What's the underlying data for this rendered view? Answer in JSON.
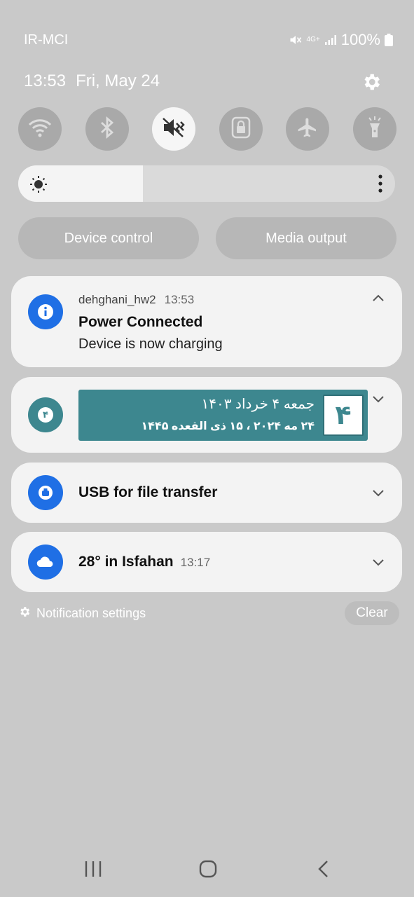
{
  "status_bar": {
    "carrier": "IR-MCI",
    "network": "4G+",
    "battery": "100%"
  },
  "header": {
    "time": "13:53",
    "date": "Fri, May 24"
  },
  "quick_settings": [
    {
      "name": "wifi",
      "icon": "wifi-icon",
      "active": false
    },
    {
      "name": "bluetooth",
      "icon": "bluetooth-icon",
      "active": false
    },
    {
      "name": "sound",
      "icon": "mute-icon",
      "active": true
    },
    {
      "name": "rotation-lock",
      "icon": "lock-icon",
      "active": false
    },
    {
      "name": "airplane",
      "icon": "airplane-icon",
      "active": false
    },
    {
      "name": "flashlight",
      "icon": "flashlight-icon",
      "active": false
    }
  ],
  "brightness": {
    "level": 0.33
  },
  "pills": {
    "device_control": "Device control",
    "media_output": "Media output"
  },
  "notifications": {
    "power": {
      "app": "dehghani_hw2",
      "time": "13:53",
      "title": "Power Connected",
      "text": "Device is now charging",
      "icon": "info-icon",
      "color": "#1f6fe5"
    },
    "calendar": {
      "badge": "۴",
      "day": "۴",
      "line1": "جمعه ۴ خرداد ۱۴۰۳",
      "line2": "۲۴ مه ۲۰۲۴ ، ۱۵ ذی القعده ۱۴۴۵",
      "color": "#3d878f"
    },
    "usb": {
      "title": "USB for file transfer",
      "icon": "usb-icon",
      "color": "#1f6fe5"
    },
    "weather": {
      "title": "28° in Isfahan",
      "time": "13:17",
      "icon": "cloud-icon",
      "color": "#1f6fe5"
    }
  },
  "footer": {
    "notification_settings": "Notification settings",
    "clear": "Clear"
  }
}
